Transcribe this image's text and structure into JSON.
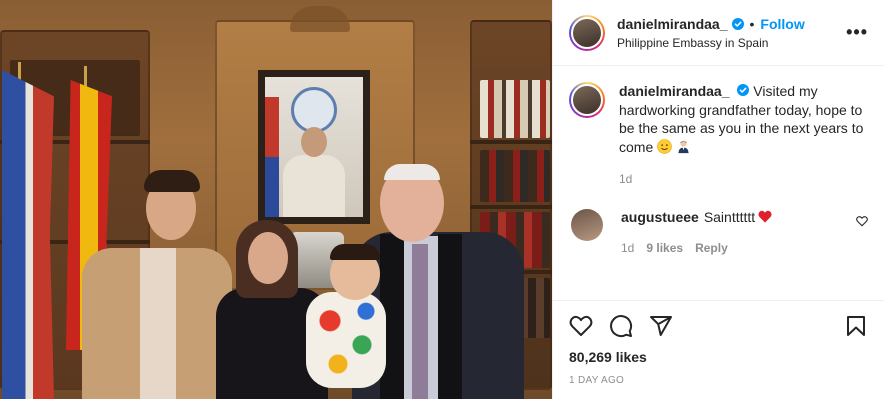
{
  "post": {
    "author": {
      "username": "danielmirandaa_",
      "verified": true,
      "follow_label": "Follow",
      "location": "Philippine Embassy in Spain"
    },
    "more_icon": "more-horizontal-icon",
    "caption": {
      "username": "danielmirandaa_",
      "text": "Visited my hardworking grandfather today, hope to be the same as you in the next years to come",
      "emojis": [
        "slightly-smiling-face",
        "person-in-tuxedo-light-skin"
      ],
      "age": "1d"
    },
    "comments": [
      {
        "username": "augustueee",
        "text": "Saintttttt",
        "emoji": "red-heart",
        "age": "1d",
        "likes": "9 likes",
        "reply_label": "Reply"
      }
    ],
    "actions": {
      "like_icon": "heart-outline-icon",
      "comment_icon": "comment-bubble-icon",
      "share_icon": "paper-plane-icon",
      "save_icon": "bookmark-icon"
    },
    "likes": "80,269 likes",
    "posted": "1 DAY AGO"
  },
  "colors": {
    "link_blue": "#0095f6",
    "text": "#262626",
    "muted": "#8e8e8e",
    "heart_red": "#ed4956",
    "border": "#efefef"
  }
}
